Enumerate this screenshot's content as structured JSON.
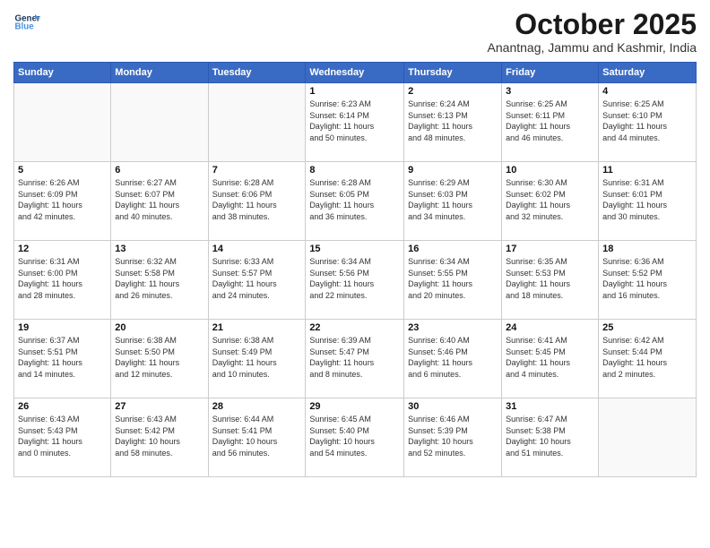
{
  "header": {
    "logo_line1": "General",
    "logo_line2": "Blue",
    "month": "October 2025",
    "location": "Anantnag, Jammu and Kashmir, India"
  },
  "weekdays": [
    "Sunday",
    "Monday",
    "Tuesday",
    "Wednesday",
    "Thursday",
    "Friday",
    "Saturday"
  ],
  "weeks": [
    [
      {
        "day": "",
        "info": ""
      },
      {
        "day": "",
        "info": ""
      },
      {
        "day": "",
        "info": ""
      },
      {
        "day": "1",
        "info": "Sunrise: 6:23 AM\nSunset: 6:14 PM\nDaylight: 11 hours\nand 50 minutes."
      },
      {
        "day": "2",
        "info": "Sunrise: 6:24 AM\nSunset: 6:13 PM\nDaylight: 11 hours\nand 48 minutes."
      },
      {
        "day": "3",
        "info": "Sunrise: 6:25 AM\nSunset: 6:11 PM\nDaylight: 11 hours\nand 46 minutes."
      },
      {
        "day": "4",
        "info": "Sunrise: 6:25 AM\nSunset: 6:10 PM\nDaylight: 11 hours\nand 44 minutes."
      }
    ],
    [
      {
        "day": "5",
        "info": "Sunrise: 6:26 AM\nSunset: 6:09 PM\nDaylight: 11 hours\nand 42 minutes."
      },
      {
        "day": "6",
        "info": "Sunrise: 6:27 AM\nSunset: 6:07 PM\nDaylight: 11 hours\nand 40 minutes."
      },
      {
        "day": "7",
        "info": "Sunrise: 6:28 AM\nSunset: 6:06 PM\nDaylight: 11 hours\nand 38 minutes."
      },
      {
        "day": "8",
        "info": "Sunrise: 6:28 AM\nSunset: 6:05 PM\nDaylight: 11 hours\nand 36 minutes."
      },
      {
        "day": "9",
        "info": "Sunrise: 6:29 AM\nSunset: 6:03 PM\nDaylight: 11 hours\nand 34 minutes."
      },
      {
        "day": "10",
        "info": "Sunrise: 6:30 AM\nSunset: 6:02 PM\nDaylight: 11 hours\nand 32 minutes."
      },
      {
        "day": "11",
        "info": "Sunrise: 6:31 AM\nSunset: 6:01 PM\nDaylight: 11 hours\nand 30 minutes."
      }
    ],
    [
      {
        "day": "12",
        "info": "Sunrise: 6:31 AM\nSunset: 6:00 PM\nDaylight: 11 hours\nand 28 minutes."
      },
      {
        "day": "13",
        "info": "Sunrise: 6:32 AM\nSunset: 5:58 PM\nDaylight: 11 hours\nand 26 minutes."
      },
      {
        "day": "14",
        "info": "Sunrise: 6:33 AM\nSunset: 5:57 PM\nDaylight: 11 hours\nand 24 minutes."
      },
      {
        "day": "15",
        "info": "Sunrise: 6:34 AM\nSunset: 5:56 PM\nDaylight: 11 hours\nand 22 minutes."
      },
      {
        "day": "16",
        "info": "Sunrise: 6:34 AM\nSunset: 5:55 PM\nDaylight: 11 hours\nand 20 minutes."
      },
      {
        "day": "17",
        "info": "Sunrise: 6:35 AM\nSunset: 5:53 PM\nDaylight: 11 hours\nand 18 minutes."
      },
      {
        "day": "18",
        "info": "Sunrise: 6:36 AM\nSunset: 5:52 PM\nDaylight: 11 hours\nand 16 minutes."
      }
    ],
    [
      {
        "day": "19",
        "info": "Sunrise: 6:37 AM\nSunset: 5:51 PM\nDaylight: 11 hours\nand 14 minutes."
      },
      {
        "day": "20",
        "info": "Sunrise: 6:38 AM\nSunset: 5:50 PM\nDaylight: 11 hours\nand 12 minutes."
      },
      {
        "day": "21",
        "info": "Sunrise: 6:38 AM\nSunset: 5:49 PM\nDaylight: 11 hours\nand 10 minutes."
      },
      {
        "day": "22",
        "info": "Sunrise: 6:39 AM\nSunset: 5:47 PM\nDaylight: 11 hours\nand 8 minutes."
      },
      {
        "day": "23",
        "info": "Sunrise: 6:40 AM\nSunset: 5:46 PM\nDaylight: 11 hours\nand 6 minutes."
      },
      {
        "day": "24",
        "info": "Sunrise: 6:41 AM\nSunset: 5:45 PM\nDaylight: 11 hours\nand 4 minutes."
      },
      {
        "day": "25",
        "info": "Sunrise: 6:42 AM\nSunset: 5:44 PM\nDaylight: 11 hours\nand 2 minutes."
      }
    ],
    [
      {
        "day": "26",
        "info": "Sunrise: 6:43 AM\nSunset: 5:43 PM\nDaylight: 11 hours\nand 0 minutes."
      },
      {
        "day": "27",
        "info": "Sunrise: 6:43 AM\nSunset: 5:42 PM\nDaylight: 10 hours\nand 58 minutes."
      },
      {
        "day": "28",
        "info": "Sunrise: 6:44 AM\nSunset: 5:41 PM\nDaylight: 10 hours\nand 56 minutes."
      },
      {
        "day": "29",
        "info": "Sunrise: 6:45 AM\nSunset: 5:40 PM\nDaylight: 10 hours\nand 54 minutes."
      },
      {
        "day": "30",
        "info": "Sunrise: 6:46 AM\nSunset: 5:39 PM\nDaylight: 10 hours\nand 52 minutes."
      },
      {
        "day": "31",
        "info": "Sunrise: 6:47 AM\nSunset: 5:38 PM\nDaylight: 10 hours\nand 51 minutes."
      },
      {
        "day": "",
        "info": ""
      }
    ]
  ]
}
